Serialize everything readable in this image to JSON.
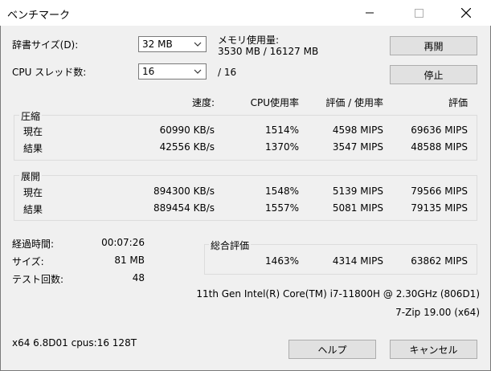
{
  "window": {
    "title": "ベンチマーク",
    "minimize": "—",
    "maximize": "☐",
    "close": "✕"
  },
  "settings": {
    "dict_label": "辞書サイズ(D):",
    "dict_value": "32 MB",
    "threads_label": "CPU スレッド数:",
    "threads_value": "16",
    "threads_total": "/ 16",
    "memory_label": "メモリ使用量:",
    "memory_value": "3530 MB / 16127 MB"
  },
  "buttons": {
    "restart": "再開",
    "stop": "停止",
    "help": "ヘルプ",
    "cancel": "キャンセル"
  },
  "columns": {
    "speed": "速度:",
    "cpu_usage": "CPU使用率",
    "rating_per_usage": "評価 / 使用率",
    "rating": "評価"
  },
  "compress": {
    "title": "圧縮",
    "rows": [
      {
        "label": "現在",
        "speed": "60990 KB/s",
        "cpu": "1514%",
        "rpu": "4598 MIPS",
        "rating": "69636 MIPS"
      },
      {
        "label": "結果",
        "speed": "42556 KB/s",
        "cpu": "1370%",
        "rpu": "3547 MIPS",
        "rating": "48588 MIPS"
      }
    ]
  },
  "decompress": {
    "title": "展開",
    "rows": [
      {
        "label": "現在",
        "speed": "894300 KB/s",
        "cpu": "1548%",
        "rpu": "5139 MIPS",
        "rating": "79566 MIPS"
      },
      {
        "label": "結果",
        "speed": "889454 KB/s",
        "cpu": "1557%",
        "rpu": "5081 MIPS",
        "rating": "79135 MIPS"
      }
    ]
  },
  "stats": {
    "elapsed_label": "経過時間:",
    "elapsed_value": "00:07:26",
    "size_label": "サイズ:",
    "size_value": "81 MB",
    "passes_label": "テスト回数:",
    "passes_value": "48"
  },
  "total": {
    "title": "総合評価",
    "cpu": "1463%",
    "rpu": "4314 MIPS",
    "rating": "63862 MIPS"
  },
  "system": {
    "cpu_name": "11th Gen Intel(R) Core(TM) i7-11800H @ 2.30GHz (806D1)",
    "version": "7-Zip 19.00 (x64)",
    "arch": "x64 6.8D01 cpus:16 128T"
  }
}
